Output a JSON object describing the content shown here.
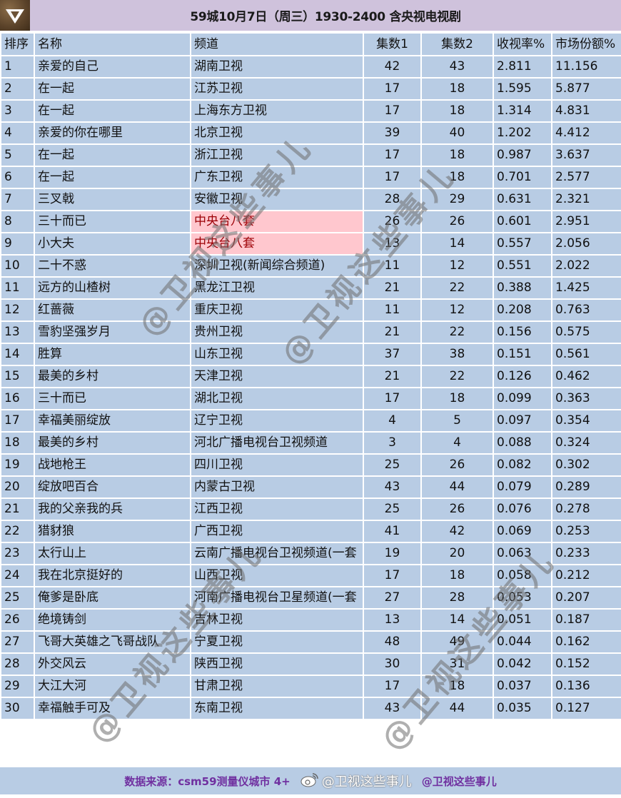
{
  "title": "59城10月7日（周三）1930-2400 含央视电视剧",
  "logo_icon": "diamond-v-logo-icon",
  "columns": [
    "排序",
    "名称",
    "频道",
    "集数1",
    "集数2",
    "收视率%",
    "市场份额%"
  ],
  "highlight_colors": {
    "bg": "#ffc7ce",
    "text": "#9c0006"
  },
  "rows": [
    {
      "rank": "1",
      "name": "亲爱的自己",
      "channel": "湖南卫视",
      "ep1": "42",
      "ep2": "43",
      "rating": "2.811",
      "share": "11.156",
      "hl": false
    },
    {
      "rank": "2",
      "name": "在一起",
      "channel": "江苏卫视",
      "ep1": "17",
      "ep2": "18",
      "rating": "1.595",
      "share": "5.877",
      "hl": false
    },
    {
      "rank": "3",
      "name": "在一起",
      "channel": "上海东方卫视",
      "ep1": "17",
      "ep2": "18",
      "rating": "1.314",
      "share": "4.831",
      "hl": false
    },
    {
      "rank": "4",
      "name": "亲爱的你在哪里",
      "channel": "北京卫视",
      "ep1": "39",
      "ep2": "40",
      "rating": "1.202",
      "share": "4.412",
      "hl": false
    },
    {
      "rank": "5",
      "name": "在一起",
      "channel": "浙江卫视",
      "ep1": "17",
      "ep2": "18",
      "rating": "0.987",
      "share": "3.637",
      "hl": false
    },
    {
      "rank": "6",
      "name": "在一起",
      "channel": "广东卫视",
      "ep1": "17",
      "ep2": "18",
      "rating": "0.701",
      "share": "2.577",
      "hl": false
    },
    {
      "rank": "7",
      "name": "三叉戟",
      "channel": "安徽卫视",
      "ep1": "28",
      "ep2": "29",
      "rating": "0.631",
      "share": "2.321",
      "hl": false
    },
    {
      "rank": "8",
      "name": "三十而已",
      "channel": "中央台八套",
      "ep1": "26",
      "ep2": "26",
      "rating": "0.601",
      "share": "2.951",
      "hl": true
    },
    {
      "rank": "9",
      "name": "小大夫",
      "channel": "中央台八套",
      "ep1": "13",
      "ep2": "14",
      "rating": "0.557",
      "share": "2.056",
      "hl": true
    },
    {
      "rank": "10",
      "name": "二十不惑",
      "channel": "深圳卫视(新闻综合频道)",
      "ep1": "11",
      "ep2": "12",
      "rating": "0.551",
      "share": "2.022",
      "hl": false
    },
    {
      "rank": "11",
      "name": "远方的山楂树",
      "channel": "黑龙江卫视",
      "ep1": "21",
      "ep2": "22",
      "rating": "0.388",
      "share": "1.425",
      "hl": false
    },
    {
      "rank": "12",
      "name": "红蔷薇",
      "channel": "重庆卫视",
      "ep1": "11",
      "ep2": "12",
      "rating": "0.208",
      "share": "0.763",
      "hl": false
    },
    {
      "rank": "13",
      "name": "雪豹坚强岁月",
      "channel": "贵州卫视",
      "ep1": "21",
      "ep2": "22",
      "rating": "0.156",
      "share": "0.575",
      "hl": false
    },
    {
      "rank": "14",
      "name": "胜算",
      "channel": "山东卫视",
      "ep1": "37",
      "ep2": "38",
      "rating": "0.151",
      "share": "0.561",
      "hl": false
    },
    {
      "rank": "15",
      "name": "最美的乡村",
      "channel": "天津卫视",
      "ep1": "21",
      "ep2": "22",
      "rating": "0.126",
      "share": "0.462",
      "hl": false
    },
    {
      "rank": "16",
      "name": "三十而已",
      "channel": "湖北卫视",
      "ep1": "17",
      "ep2": "18",
      "rating": "0.099",
      "share": "0.363",
      "hl": false
    },
    {
      "rank": "17",
      "name": "幸福美丽绽放",
      "channel": "辽宁卫视",
      "ep1": "4",
      "ep2": "5",
      "rating": "0.097",
      "share": "0.354",
      "hl": false
    },
    {
      "rank": "18",
      "name": "最美的乡村",
      "channel": "河北广播电视台卫视频道",
      "ep1": "3",
      "ep2": "4",
      "rating": "0.088",
      "share": "0.324",
      "hl": false
    },
    {
      "rank": "19",
      "name": "战地枪王",
      "channel": "四川卫视",
      "ep1": "25",
      "ep2": "26",
      "rating": "0.082",
      "share": "0.302",
      "hl": false
    },
    {
      "rank": "20",
      "name": "绽放吧百合",
      "channel": "内蒙古卫视",
      "ep1": "43",
      "ep2": "44",
      "rating": "0.079",
      "share": "0.289",
      "hl": false
    },
    {
      "rank": "21",
      "name": "我的父亲我的兵",
      "channel": "江西卫视",
      "ep1": "25",
      "ep2": "26",
      "rating": "0.076",
      "share": "0.278",
      "hl": false
    },
    {
      "rank": "22",
      "name": "猎豺狼",
      "channel": "广西卫视",
      "ep1": "41",
      "ep2": "42",
      "rating": "0.069",
      "share": "0.253",
      "hl": false
    },
    {
      "rank": "23",
      "name": "太行山上",
      "channel": "云南广播电视台卫视频道(一套",
      "ep1": "19",
      "ep2": "20",
      "rating": "0.063",
      "share": "0.233",
      "hl": false
    },
    {
      "rank": "24",
      "name": "我在北京挺好的",
      "channel": "山西卫视",
      "ep1": "17",
      "ep2": "18",
      "rating": "0.058",
      "share": "0.212",
      "hl": false
    },
    {
      "rank": "25",
      "name": "俺爹是卧底",
      "channel": "河南广播电视台卫星频道(一套",
      "ep1": "27",
      "ep2": "28",
      "rating": "0.053",
      "share": "0.207",
      "hl": false
    },
    {
      "rank": "26",
      "name": "绝境铸剑",
      "channel": "吉林卫视",
      "ep1": "13",
      "ep2": "14",
      "rating": "0.051",
      "share": "0.187",
      "hl": false
    },
    {
      "rank": "27",
      "name": "飞哥大英雄之飞哥战队",
      "channel": "宁夏卫视",
      "ep1": "48",
      "ep2": "49",
      "rating": "0.044",
      "share": "0.162",
      "hl": false
    },
    {
      "rank": "28",
      "name": "外交风云",
      "channel": "陕西卫视",
      "ep1": "30",
      "ep2": "31",
      "rating": "0.042",
      "share": "0.152",
      "hl": false
    },
    {
      "rank": "29",
      "name": "大江大河",
      "channel": "甘肃卫视",
      "ep1": "17",
      "ep2": "18",
      "rating": "0.037",
      "share": "0.136",
      "hl": false
    },
    {
      "rank": "30",
      "name": "幸福触手可及",
      "channel": "东南卫视",
      "ep1": "43",
      "ep2": "44",
      "rating": "0.035",
      "share": "0.127",
      "hl": false
    }
  ],
  "footer": {
    "source": "数据来源：csm59测量仪城市 4+",
    "weibo_icon": "weibo-icon",
    "weibo_handle": "@卫视这些事儿",
    "credit": "@卫视这些事儿"
  },
  "watermark_text": "@卫视这些事儿"
}
